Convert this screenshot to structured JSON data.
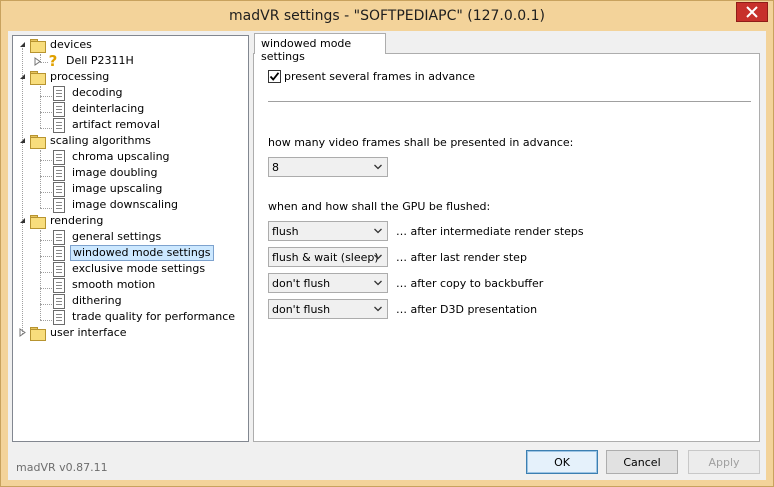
{
  "window": {
    "title": "madVR settings - \"SOFTPEDIAPC\" (127.0.0.1)"
  },
  "tree": {
    "devices": "devices",
    "device_1": "Dell P2311H",
    "processing": "processing",
    "decoding": "decoding",
    "deinterlacing": "deinterlacing",
    "artifact_removal": "artifact removal",
    "scaling_algorithms": "scaling algorithms",
    "chroma_upscaling": "chroma upscaling",
    "image_doubling": "image doubling",
    "image_upscaling": "image upscaling",
    "image_downscaling": "image downscaling",
    "rendering": "rendering",
    "general_settings": "general settings",
    "windowed_mode_settings": "windowed mode settings",
    "exclusive_mode_settings": "exclusive mode settings",
    "smooth_motion": "smooth motion",
    "dithering": "dithering",
    "trade_quality": "trade quality for performance",
    "user_interface": "user interface"
  },
  "panel": {
    "tab_label": "windowed mode settings",
    "present_frames_label": "present several frames in advance",
    "present_frames_checked": true,
    "frames_question": "how many video frames shall be presented in advance:",
    "frames_value": "8",
    "flush_question": "when and how shall the GPU be flushed:",
    "flush_rows": [
      {
        "value": "flush",
        "label": "… after intermediate render steps"
      },
      {
        "value": "flush & wait (sleep)",
        "label": "… after last render step"
      },
      {
        "value": "don't flush",
        "label": "… after copy to backbuffer"
      },
      {
        "value": "don't flush",
        "label": "… after D3D presentation"
      }
    ]
  },
  "footer": {
    "version": "madVR v0.87.11",
    "ok": "OK",
    "cancel": "Cancel",
    "apply": "Apply"
  }
}
